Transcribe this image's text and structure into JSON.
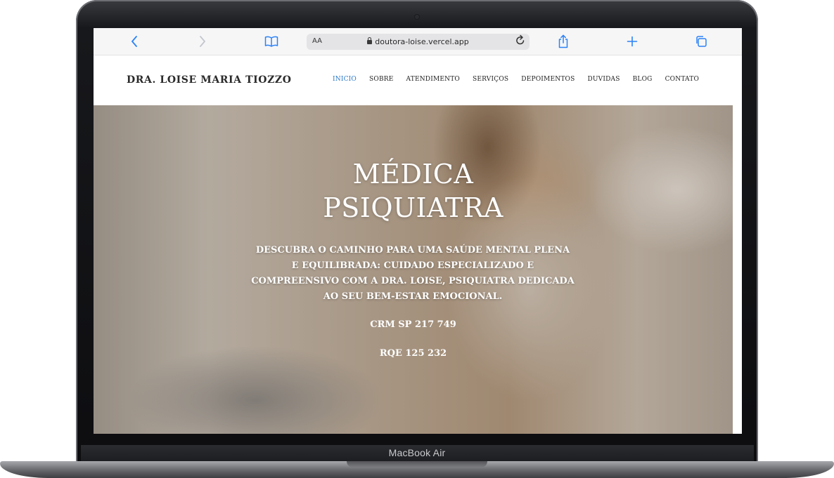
{
  "device": {
    "model_label": "MacBook Air"
  },
  "browser": {
    "aa_label": "AA",
    "url": "doutora-loise.vercel.app",
    "icons": {
      "back": "chevron-left-icon",
      "forward": "chevron-right-icon",
      "bookmarks": "book-icon",
      "reload": "reload-icon",
      "share": "share-icon",
      "new_tab": "plus-icon",
      "tabs": "tabs-icon"
    },
    "accent_color": "#2b82f6"
  },
  "site": {
    "brand": "DRA. LOISE MARIA TIOZZO",
    "nav": [
      "INICIO",
      "SOBRE",
      "ATENDIMENTO",
      "SERVIÇOS",
      "DEPOIMENTOS",
      "DUVIDAS",
      "BLOG",
      "CONTATO"
    ],
    "active_nav": "INICIO",
    "active_color": "#2a78c8"
  },
  "hero": {
    "title_line1": "MÉDICA",
    "title_line2": "PSIQUIATRA",
    "description": "DESCUBRA O CAMINHO PARA UMA SAÚDE MENTAL PLENA E EQUILIBRADA: CUIDADO ESPECIALIZADO E COMPREENSIVO COM A DRA. LOISE, PSIQUIATRA DEDICADA AO SEU BEM-ESTAR EMOCIONAL.",
    "crm": "CRM SP 217 749",
    "rqe": "RQE 125 232"
  }
}
